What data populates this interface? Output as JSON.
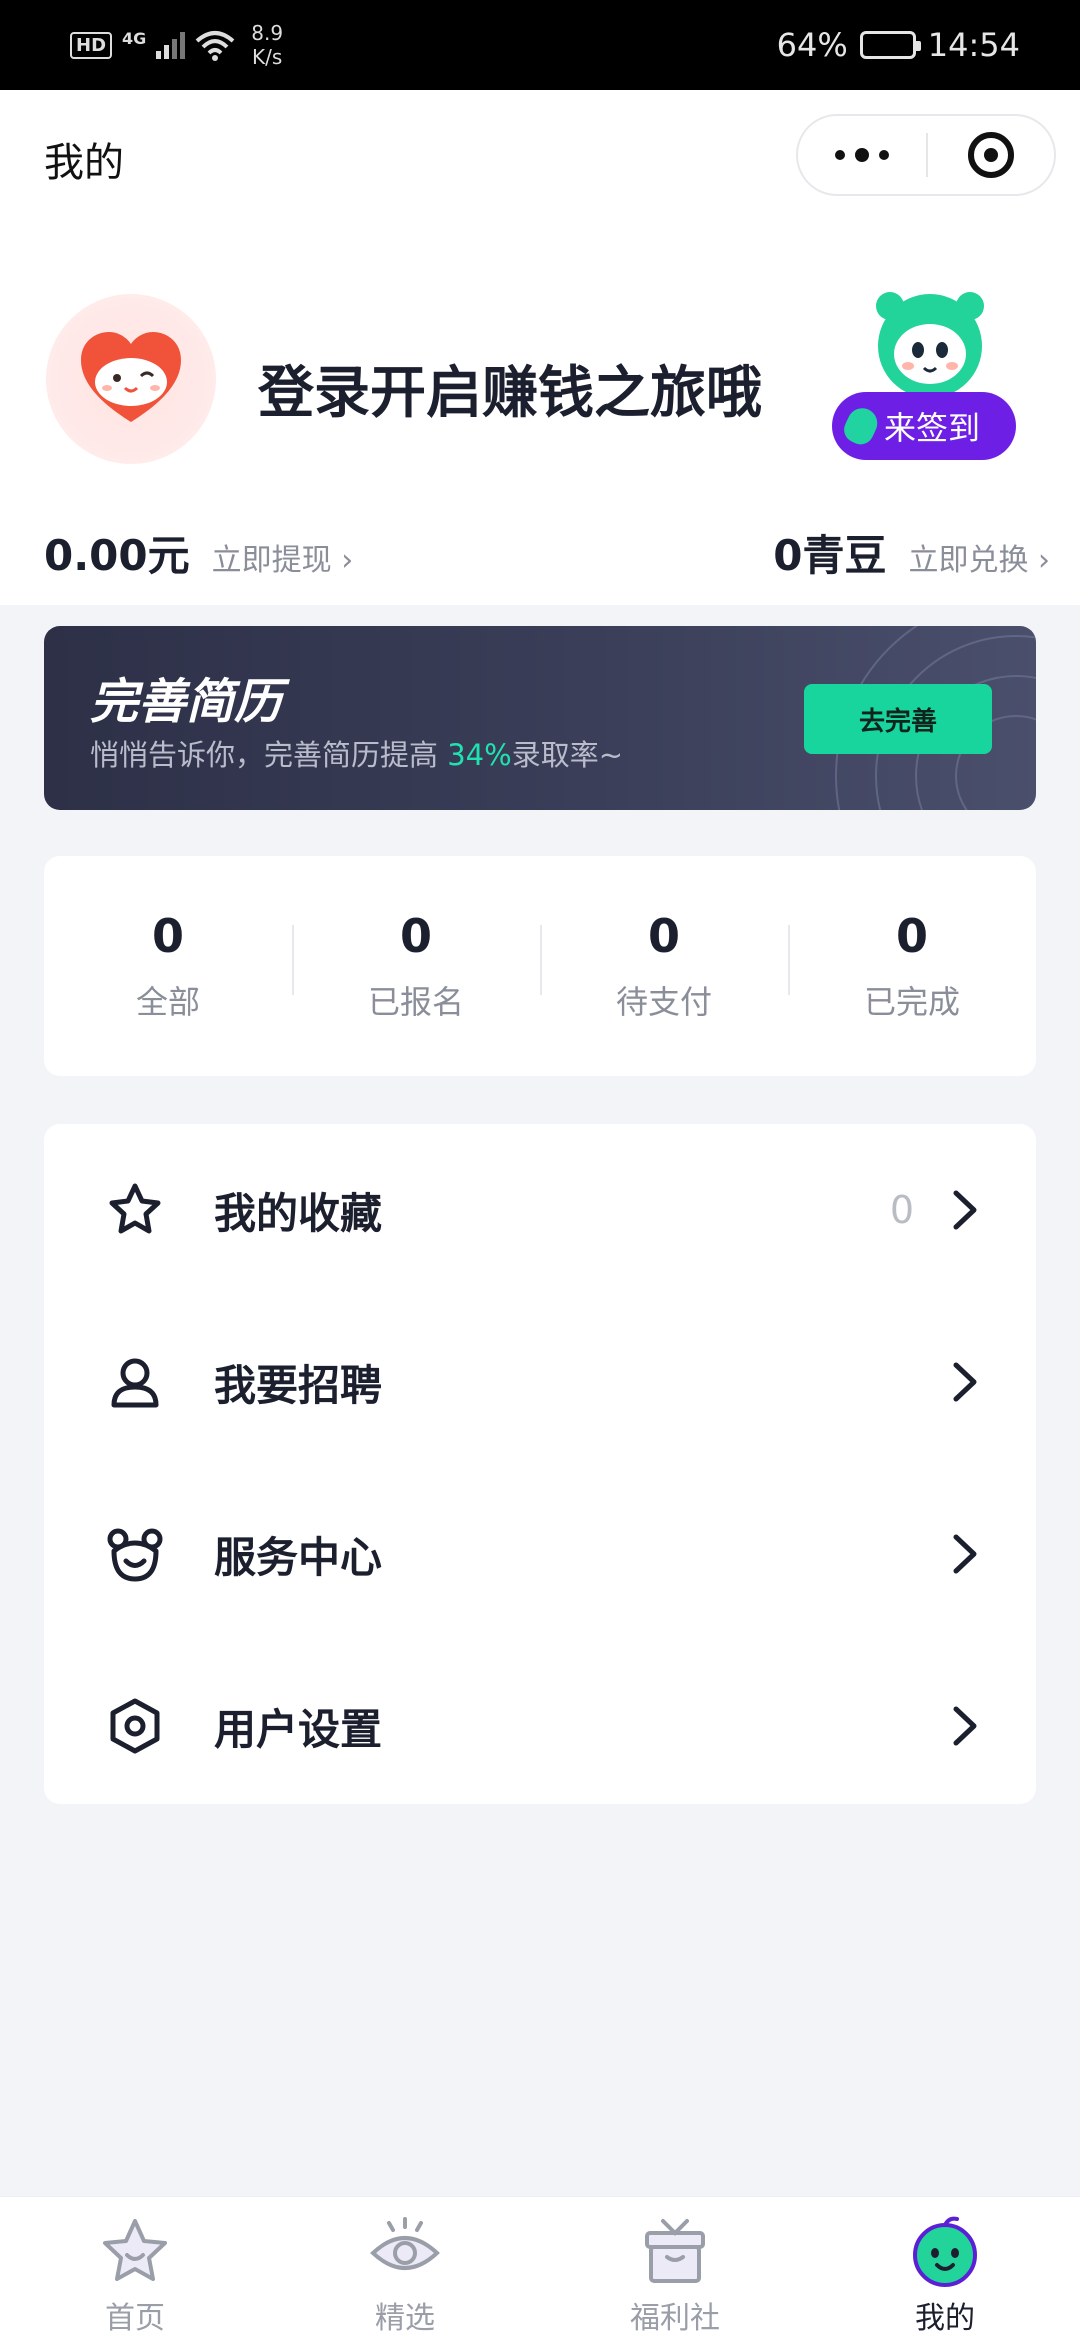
{
  "status_bar": {
    "network_badge": "HD",
    "network_type": "4G",
    "speed_value": "8.9",
    "speed_unit": "K/s",
    "battery_text": "64%",
    "battery_level": 0.64,
    "time": "14:54"
  },
  "header": {
    "title": "我的"
  },
  "profile": {
    "login_prompt": "登录开启赚钱之旅哦",
    "signin_label": "来签到",
    "balance": "0.00元",
    "withdraw_link": "立即提现",
    "beans": "0青豆",
    "redeem_link": "立即兑换"
  },
  "banner": {
    "title": "完善简历",
    "subtitle_prefix": "悄悄告诉你，完善简历提高 ",
    "subtitle_highlight": "34%",
    "subtitle_suffix": "录取率~",
    "button_label": "去完善"
  },
  "order_stats": [
    {
      "count": "0",
      "label": "全部"
    },
    {
      "count": "0",
      "label": "已报名"
    },
    {
      "count": "0",
      "label": "待支付"
    },
    {
      "count": "0",
      "label": "已完成"
    }
  ],
  "menu": [
    {
      "label": "我的收藏",
      "icon": "star-icon",
      "count": "0"
    },
    {
      "label": "我要招聘",
      "icon": "person-icon",
      "count": ""
    },
    {
      "label": "服务中心",
      "icon": "bear-face-icon",
      "count": ""
    },
    {
      "label": "用户设置",
      "icon": "hexagon-settings-icon",
      "count": ""
    }
  ],
  "tabs": [
    {
      "label": "首页",
      "icon": "home-star-icon",
      "active": false
    },
    {
      "label": "精选",
      "icon": "eye-icon",
      "active": false
    },
    {
      "label": "福利社",
      "icon": "gift-box-icon",
      "active": false
    },
    {
      "label": "我的",
      "icon": "mascot-face-icon",
      "active": true
    }
  ],
  "colors": {
    "accent_green": "#18d59d",
    "signin_purple": "#6d1fe6",
    "text_dark": "#1b1f2e",
    "text_muted": "#8a8e99",
    "background": "#f3f4f8"
  }
}
